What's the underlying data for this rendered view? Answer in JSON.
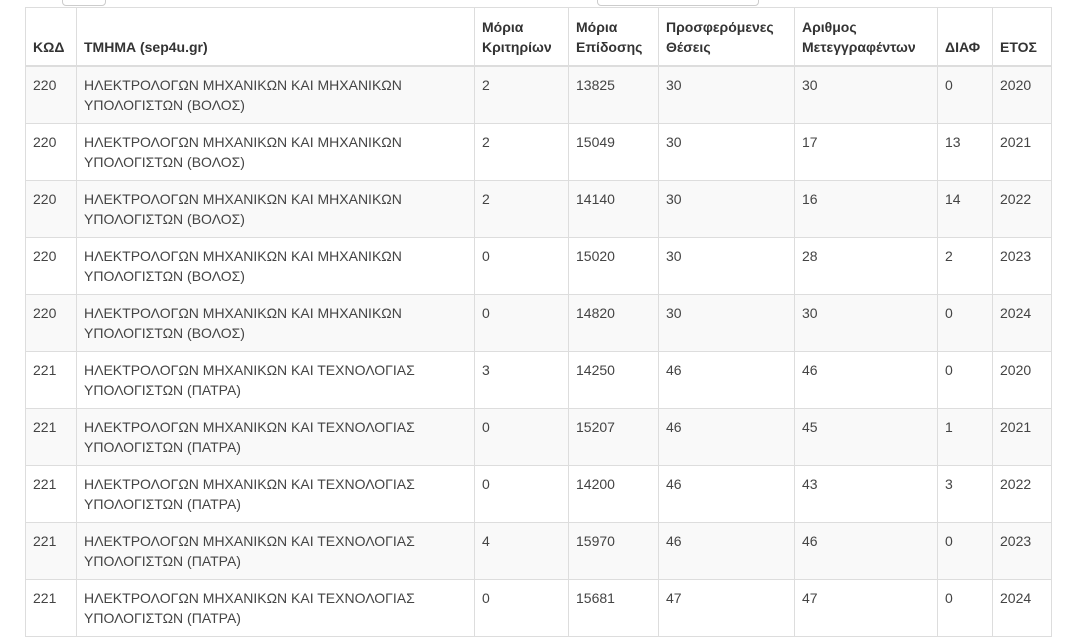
{
  "columns": {
    "code": "ΚΩΔ",
    "department": "ΤΜΗΜΑ (sep4u.gr)",
    "criteria_points": "Μόρια Κριτηρίων",
    "achievement_points": "Μόρια Επίδοσης",
    "offered_places": "Προσφερόμενες Θέσεις",
    "transfers_count": "Αριθμος Μετεγγραφέντων",
    "difference": "ΔΙΑΦ",
    "year": "ΕΤΟΣ"
  },
  "rows": [
    {
      "code": "220",
      "department": "ΗΛΕΚΤΡΟΛΟΓΩΝ ΜΗΧΑΝΙΚΩΝ ΚΑΙ ΜΗΧΑΝΙΚΩΝ ΥΠΟΛΟΓΙΣΤΩΝ (ΒΟΛΟΣ)",
      "criteria_points": "2",
      "achievement_points": "13825",
      "offered_places": "30",
      "transfers_count": "30",
      "difference": "0",
      "year": "2020"
    },
    {
      "code": "220",
      "department": "ΗΛΕΚΤΡΟΛΟΓΩΝ ΜΗΧΑΝΙΚΩΝ ΚΑΙ ΜΗΧΑΝΙΚΩΝ ΥΠΟΛΟΓΙΣΤΩΝ (ΒΟΛΟΣ)",
      "criteria_points": "2",
      "achievement_points": "15049",
      "offered_places": "30",
      "transfers_count": "17",
      "difference": "13",
      "year": "2021"
    },
    {
      "code": "220",
      "department": "ΗΛΕΚΤΡΟΛΟΓΩΝ ΜΗΧΑΝΙΚΩΝ ΚΑΙ ΜΗΧΑΝΙΚΩΝ ΥΠΟΛΟΓΙΣΤΩΝ (ΒΟΛΟΣ)",
      "criteria_points": "2",
      "achievement_points": "14140",
      "offered_places": "30",
      "transfers_count": "16",
      "difference": "14",
      "year": "2022"
    },
    {
      "code": "220",
      "department": "ΗΛΕΚΤΡΟΛΟΓΩΝ ΜΗΧΑΝΙΚΩΝ ΚΑΙ ΜΗΧΑΝΙΚΩΝ ΥΠΟΛΟΓΙΣΤΩΝ (ΒΟΛΟΣ)",
      "criteria_points": "0",
      "achievement_points": "15020",
      "offered_places": "30",
      "transfers_count": "28",
      "difference": "2",
      "year": "2023"
    },
    {
      "code": "220",
      "department": "ΗΛΕΚΤΡΟΛΟΓΩΝ ΜΗΧΑΝΙΚΩΝ ΚΑΙ ΜΗΧΑΝΙΚΩΝ ΥΠΟΛΟΓΙΣΤΩΝ (ΒΟΛΟΣ)",
      "criteria_points": "0",
      "achievement_points": "14820",
      "offered_places": "30",
      "transfers_count": "30",
      "difference": "0",
      "year": "2024"
    },
    {
      "code": "221",
      "department": "ΗΛΕΚΤΡΟΛΟΓΩΝ ΜΗΧΑΝΙΚΩΝ ΚΑΙ ΤΕΧΝΟΛΟΓΙΑΣ ΥΠΟΛΟΓΙΣΤΩΝ (ΠΑΤΡΑ)",
      "criteria_points": "3",
      "achievement_points": "14250",
      "offered_places": "46",
      "transfers_count": "46",
      "difference": "0",
      "year": "2020"
    },
    {
      "code": "221",
      "department": "ΗΛΕΚΤΡΟΛΟΓΩΝ ΜΗΧΑΝΙΚΩΝ ΚΑΙ ΤΕΧΝΟΛΟΓΙΑΣ ΥΠΟΛΟΓΙΣΤΩΝ (ΠΑΤΡΑ)",
      "criteria_points": "0",
      "achievement_points": "15207",
      "offered_places": "46",
      "transfers_count": "45",
      "difference": "1",
      "year": "2021"
    },
    {
      "code": "221",
      "department": "ΗΛΕΚΤΡΟΛΟΓΩΝ ΜΗΧΑΝΙΚΩΝ ΚΑΙ ΤΕΧΝΟΛΟΓΙΑΣ ΥΠΟΛΟΓΙΣΤΩΝ (ΠΑΤΡΑ)",
      "criteria_points": "0",
      "achievement_points": "14200",
      "offered_places": "46",
      "transfers_count": "43",
      "difference": "3",
      "year": "2022"
    },
    {
      "code": "221",
      "department": "ΗΛΕΚΤΡΟΛΟΓΩΝ ΜΗΧΑΝΙΚΩΝ ΚΑΙ ΤΕΧΝΟΛΟΓΙΑΣ ΥΠΟΛΟΓΙΣΤΩΝ (ΠΑΤΡΑ)",
      "criteria_points": "4",
      "achievement_points": "15970",
      "offered_places": "46",
      "transfers_count": "46",
      "difference": "0",
      "year": "2023"
    },
    {
      "code": "221",
      "department": "ΗΛΕΚΤΡΟΛΟΓΩΝ ΜΗΧΑΝΙΚΩΝ ΚΑΙ ΤΕΧΝΟΛΟΓΙΑΣ ΥΠΟΛΟΓΙΣΤΩΝ (ΠΑΤΡΑ)",
      "criteria_points": "0",
      "achievement_points": "15681",
      "offered_places": "47",
      "transfers_count": "47",
      "difference": "0",
      "year": "2024"
    }
  ]
}
